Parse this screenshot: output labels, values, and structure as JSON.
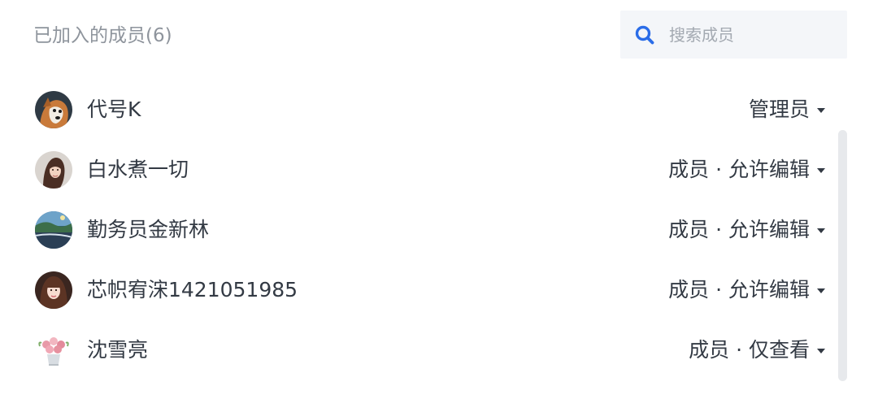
{
  "header": {
    "title": "已加入的成员(6)"
  },
  "search": {
    "placeholder": "搜索成员",
    "value": "",
    "icon": "search-icon",
    "icon_color": "#2b6de8"
  },
  "members": [
    {
      "name": "代号K",
      "role": "管理员",
      "avatar": "dog-avatar"
    },
    {
      "name": "白水煮一切",
      "role": "成员 · 允许编辑",
      "avatar": "girl-avatar"
    },
    {
      "name": "勤务员金新林",
      "role": "成员 · 允许编辑",
      "avatar": "landscape-avatar"
    },
    {
      "name": "芯帜宥浨1421051985",
      "role": "成员 · 允许编辑",
      "avatar": "portrait-avatar"
    },
    {
      "name": "沈雪亮",
      "role": "成员 · 仅查看",
      "avatar": "flower-avatar"
    }
  ],
  "colors": {
    "text_primary": "#333a44",
    "text_secondary": "#8e949c",
    "search_bg": "#f4f6f9",
    "scrollbar": "#e7e9ec"
  }
}
